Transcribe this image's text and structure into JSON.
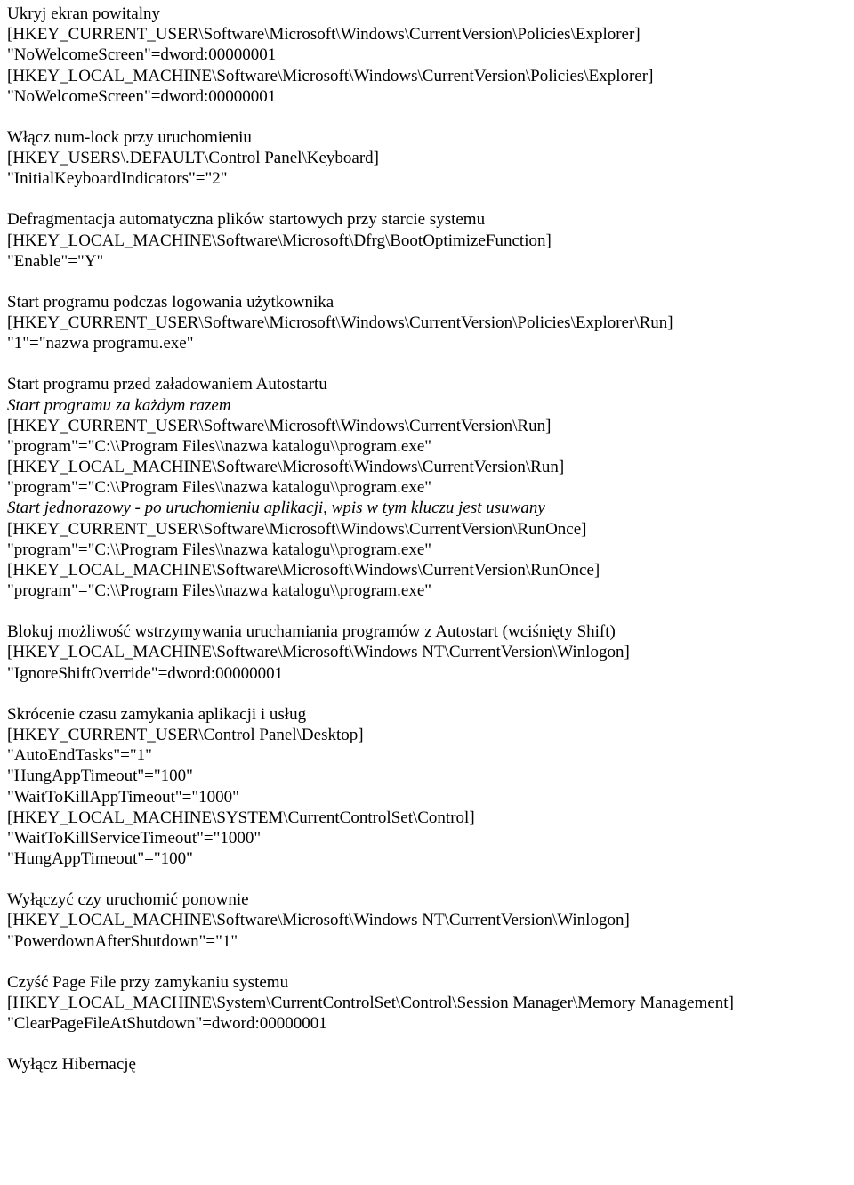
{
  "lines": [
    {
      "t": "Ukryj ekran powitalny"
    },
    {
      "t": "[HKEY_CURRENT_USER\\Software\\Microsoft\\Windows\\CurrentVersion\\Policies\\Explorer]"
    },
    {
      "t": "\"NoWelcomeScreen\"=dword:00000001"
    },
    {
      "t": "[HKEY_LOCAL_MACHINE\\Software\\Microsoft\\Windows\\CurrentVersion\\Policies\\Explorer]"
    },
    {
      "t": "\"NoWelcomeScreen\"=dword:00000001"
    },
    {
      "blank": true
    },
    {
      "t": "Włącz num-lock przy uruchomieniu"
    },
    {
      "t": "[HKEY_USERS\\.DEFAULT\\Control Panel\\Keyboard]"
    },
    {
      "t": "\"InitialKeyboardIndicators\"=\"2\""
    },
    {
      "blank": true
    },
    {
      "t": "Defragmentacja automatyczna plików startowych przy starcie systemu"
    },
    {
      "t": "[HKEY_LOCAL_MACHINE\\Software\\Microsoft\\Dfrg\\BootOptimizeFunction]"
    },
    {
      "t": "\"Enable\"=\"Y\""
    },
    {
      "blank": true
    },
    {
      "t": "Start programu podczas logowania użytkownika"
    },
    {
      "t": "[HKEY_CURRENT_USER\\Software\\Microsoft\\Windows\\CurrentVersion\\Policies\\Explorer\\Run]"
    },
    {
      "t": "\"1\"=\"nazwa programu.exe\""
    },
    {
      "blank": true
    },
    {
      "t": "Start programu przed załadowaniem Autostartu"
    },
    {
      "t": "Start programu za każdym razem",
      "italic": true
    },
    {
      "t": "[HKEY_CURRENT_USER\\Software\\Microsoft\\Windows\\CurrentVersion\\Run]"
    },
    {
      "t": "\"program\"=\"C:\\\\Program Files\\\\nazwa katalogu\\\\program.exe\""
    },
    {
      "t": "[HKEY_LOCAL_MACHINE\\Software\\Microsoft\\Windows\\CurrentVersion\\Run]"
    },
    {
      "t": "\"program\"=\"C:\\\\Program Files\\\\nazwa katalogu\\\\program.exe\""
    },
    {
      "t": "Start jednorazowy - po uruchomieniu aplikacji, wpis w tym kluczu jest usuwany",
      "italic": true
    },
    {
      "t": "[HKEY_CURRENT_USER\\Software\\Microsoft\\Windows\\CurrentVersion\\RunOnce]"
    },
    {
      "t": "\"program\"=\"C:\\\\Program Files\\\\nazwa katalogu\\\\program.exe\""
    },
    {
      "t": "[HKEY_LOCAL_MACHINE\\Software\\Microsoft\\Windows\\CurrentVersion\\RunOnce]"
    },
    {
      "t": "\"program\"=\"C:\\\\Program Files\\\\nazwa katalogu\\\\program.exe\""
    },
    {
      "blank": true
    },
    {
      "t": "Blokuj możliwość wstrzymywania uruchamiania programów z Autostart (wciśnięty Shift)"
    },
    {
      "t": "[HKEY_LOCAL_MACHINE\\Software\\Microsoft\\Windows NT\\CurrentVersion\\Winlogon]"
    },
    {
      "t": "\"IgnoreShiftOverride\"=dword:00000001"
    },
    {
      "blank": true
    },
    {
      "t": "Skrócenie czasu zamykania aplikacji i usług"
    },
    {
      "t": "[HKEY_CURRENT_USER\\Control Panel\\Desktop]"
    },
    {
      "t": "\"AutoEndTasks\"=\"1\""
    },
    {
      "t": "\"HungAppTimeout\"=\"100\""
    },
    {
      "t": "\"WaitToKillAppTimeout\"=\"1000\""
    },
    {
      "t": "[HKEY_LOCAL_MACHINE\\SYSTEM\\CurrentControlSet\\Control]"
    },
    {
      "t": "\"WaitToKillServiceTimeout\"=\"1000\""
    },
    {
      "t": "\"HungAppTimeout\"=\"100\""
    },
    {
      "blank": true
    },
    {
      "t": "Wyłączyć czy uruchomić ponownie"
    },
    {
      "t": "[HKEY_LOCAL_MACHINE\\Software\\Microsoft\\Windows NT\\CurrentVersion\\Winlogon]"
    },
    {
      "t": "\"PowerdownAfterShutdown\"=\"1\""
    },
    {
      "blank": true
    },
    {
      "t": "Czyść Page File przy zamykaniu systemu"
    },
    {
      "t": "[HKEY_LOCAL_MACHINE\\System\\CurrentControlSet\\Control\\Session Manager\\Memory Management]"
    },
    {
      "t": "\"ClearPageFileAtShutdown\"=dword:00000001"
    },
    {
      "blank": true
    },
    {
      "t": "Wyłącz Hibernację"
    }
  ]
}
